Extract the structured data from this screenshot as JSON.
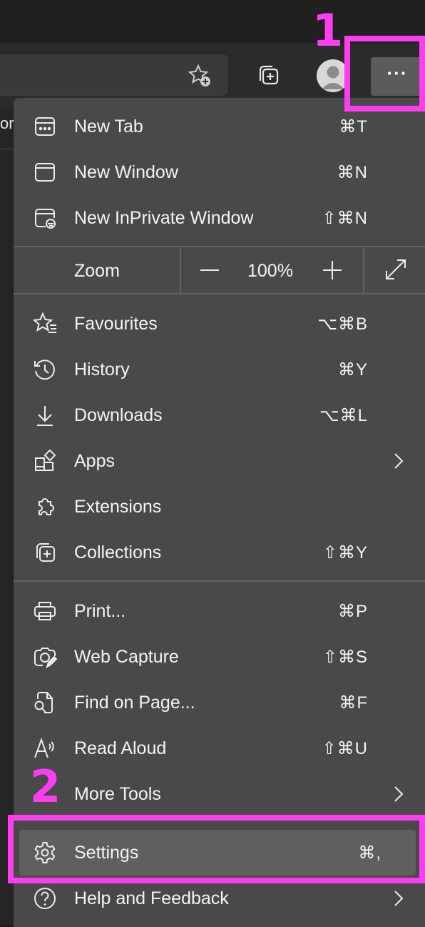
{
  "colors": {
    "annotation": "#ff3df0",
    "menu_bg": "#494949",
    "highlight": "#5f5f5f"
  },
  "toolbar": {
    "tab_fragment": "or",
    "icons": [
      "favorite-add-icon",
      "collections-icon",
      "profile-avatar-icon",
      "more-ellipsis-icon"
    ],
    "more_label": "···"
  },
  "menu": {
    "new_tab": {
      "label": "New Tab",
      "shortcut": "⌘T",
      "icon": "new-tab-icon"
    },
    "new_window": {
      "label": "New Window",
      "shortcut": "⌘N",
      "icon": "window-icon"
    },
    "new_inprivate": {
      "label": "New InPrivate Window",
      "shortcut": "⇧⌘N",
      "icon": "inprivate-window-icon"
    },
    "zoom": {
      "label": "Zoom",
      "minus": "—",
      "value": "100%",
      "plus": "+",
      "icon": "fullscreen-icon"
    },
    "favourites": {
      "label": "Favourites",
      "shortcut": "⌥⌘B",
      "icon": "favourites-icon"
    },
    "history": {
      "label": "History",
      "shortcut": "⌘Y",
      "icon": "history-icon"
    },
    "downloads": {
      "label": "Downloads",
      "shortcut": "⌥⌘L",
      "icon": "download-icon"
    },
    "apps": {
      "label": "Apps",
      "icon": "apps-icon"
    },
    "extensions": {
      "label": "Extensions",
      "icon": "extensions-icon"
    },
    "collections": {
      "label": "Collections",
      "shortcut": "⇧⌘Y",
      "icon": "collections-icon"
    },
    "print": {
      "label": "Print...",
      "shortcut": "⌘P",
      "icon": "print-icon"
    },
    "web_capture": {
      "label": "Web Capture",
      "shortcut": "⇧⌘S",
      "icon": "web-capture-icon"
    },
    "find_on_page": {
      "label": "Find on Page...",
      "shortcut": "⌘F",
      "icon": "find-on-page-icon"
    },
    "read_aloud": {
      "label": "Read Aloud",
      "shortcut": "⇧⌘U",
      "icon": "read-aloud-icon"
    },
    "more_tools": {
      "label": "More Tools"
    },
    "settings": {
      "label": "Settings",
      "shortcut": "⌘,",
      "icon": "gear-icon"
    },
    "help": {
      "label": "Help and Feedback",
      "icon": "help-icon"
    }
  },
  "annotations": {
    "step1": "1",
    "step2": "2"
  }
}
